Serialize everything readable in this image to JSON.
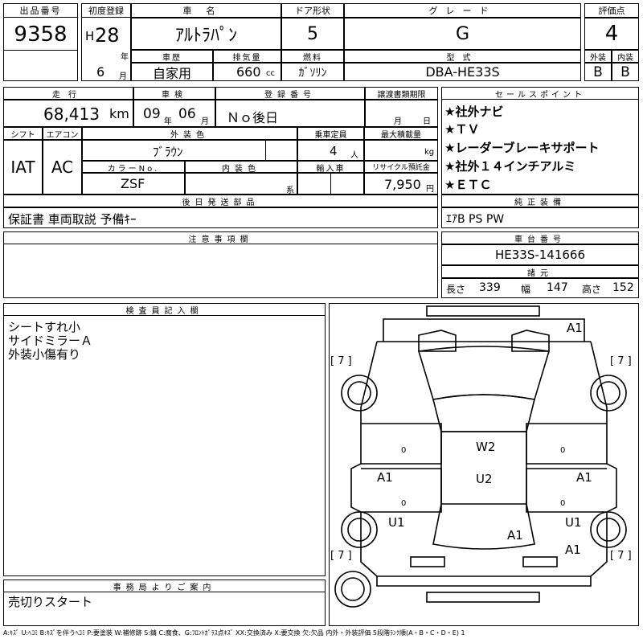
{
  "top": {
    "lot_label": "出品番号",
    "lot_number": "9358",
    "reg_label": "初度登録",
    "era": "H",
    "reg_year": "28",
    "year_unit": "年",
    "reg_month": "6",
    "month_unit": "月",
    "name_label": "車名",
    "car_name": "ｱﾙﾄﾗﾊﾟﾝ",
    "door_label": "ドア形状",
    "doors": "5",
    "grade_label": "グレード",
    "grade": "G",
    "score_label": "評価点",
    "score": "4",
    "history_label": "車歴",
    "history": "自家用",
    "displacement_label": "排気量",
    "displacement": "660",
    "cc_unit": "cc",
    "fuel_label": "燃料",
    "fuel": "ｶﾞｿﾘﾝ",
    "model_label": "型式",
    "model": "DBA-HE33S",
    "ext_label": "外装",
    "ext_grade": "B",
    "int_label": "内装",
    "int_grade": "B"
  },
  "row2": {
    "mileage_label": "走行",
    "mileage": "68,413",
    "km_unit": "km",
    "inspection_label": "車検",
    "insp_year": "09",
    "insp_year_unit": "年",
    "insp_month": "06",
    "insp_month_unit": "月",
    "regno_label": "登録番号",
    "regno": "Ｎｏ後日",
    "transfer_label": "譲渡書類期限",
    "transfer_month_unit": "月",
    "transfer_day_unit": "日",
    "shift_label": "シフト",
    "shift": "IAT",
    "ac_label": "エアコン",
    "ac": "AC",
    "color_label": "外装色",
    "color": "ﾌﾞﾗｳﾝ",
    "capacity_label": "乗車定員",
    "capacity": "4",
    "capacity_unit": "人",
    "load_label": "最大積載量",
    "load_unit": "kg",
    "colorno_label": "カラーNo.",
    "colorno": "ZSF",
    "intcolor_label": "内装色",
    "intcolor_unit": "系",
    "import_label": "輸入車",
    "recycle_label": "リサイクル預託金",
    "recycle": "7,950",
    "recycle_unit": "円",
    "later_label": "後日発送部品",
    "later": "保証書 車両取説 予備ｷｰ"
  },
  "sales": {
    "label": "セールスポイント",
    "points": [
      "★社外ナビ",
      "★ＴＶ",
      "★レーダーブレーキサポート",
      "★社外１４インチアルミ",
      "★ＥＴＣ"
    ]
  },
  "genuine": {
    "label": "純正装備",
    "value": "ｴｱB PS PW"
  },
  "notes": {
    "label": "注意事項欄"
  },
  "chassis": {
    "label": "車台番号",
    "value": "HE33S-141666",
    "dims_label": "諸元",
    "length_label": "長さ",
    "length": "339",
    "width_label": "幅",
    "width": "147",
    "height_label": "高さ",
    "height": "152"
  },
  "inspector": {
    "label": "検査員記入欄",
    "lines": [
      "シートすれ小",
      "サイドミラーＡ",
      "外装小傷有り"
    ]
  },
  "office": {
    "label": "事務局よりご案内",
    "text": "売切りスタート"
  },
  "diagram": {
    "marks": {
      "roof_a1": "A1",
      "w2": "W2",
      "u2": "U2",
      "left_a1": "A1",
      "right_a1": "A1",
      "left_u1": "U1",
      "right_u1": "U1",
      "rear_a1": "A1",
      "rear_right_a1": "A1",
      "tire_fl": "[ 7 ]",
      "tire_fr": "[ 7 ]",
      "tire_rl": "[ 7 ]",
      "tire_rr": "[ 7 ]",
      "zero_l": "0",
      "zero_r": "0",
      "zero_bl": "0",
      "zero_br": "0"
    }
  },
  "legend": "A:ｷｽﾞ U:ﾍｺﾐ B:ｷｽﾞを伴うﾍｺﾐ P:要塗装 W:補修跡 S:錆 C:腐食、G:ﾌﾛﾝﾄｶﾞﾗｽ点ｷｽﾞ XX:交換済み X:要交換 欠:欠品 内外・外装評価 5段階ﾗﾝｸ順(A・B・C・D・E) 1"
}
